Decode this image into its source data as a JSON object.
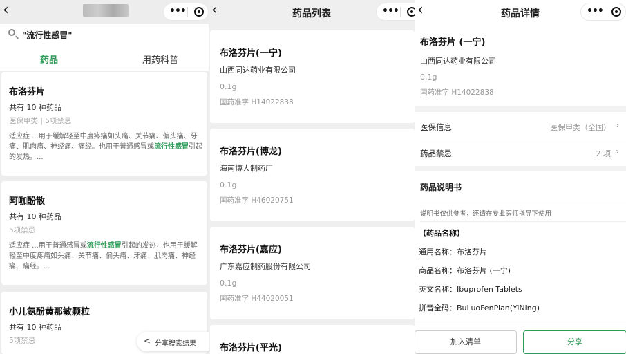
{
  "colors": {
    "accent": "#2e9b59",
    "muted": "#999999",
    "bg": "#ededed"
  },
  "icons": {
    "back": "chevron-left-icon",
    "more": "more-dots-icon",
    "target": "target-icon",
    "search": "search-icon"
  },
  "panel1": {
    "search_value": "\"流行性感冒\"",
    "tabs": [
      "药品",
      "用药科普"
    ],
    "cards": [
      {
        "name": "布洛芬片",
        "count": "共有 10 种药品",
        "meta": "医保甲类 | 5项禁忌",
        "desc_pre": "适应症 ...用于缓解轻至中度疼痛如头痛、关节痛、偏头痛、牙痛、肌肉痛、神经痛、痛经。也用于普通感冒或",
        "desc_hl": "流行性感冒",
        "desc_post": "引起的发热。..."
      },
      {
        "name": "阿咖酚散",
        "count": "共有 10 种药品",
        "meta": "5项禁忌",
        "desc_pre": "适应症 ...用于普通感冒或",
        "desc_hl": "流行性感冒",
        "desc_post": "引起的发热，也用于缓解轻至中度疼痛如头痛、关节痛、偏头痛、牙痛、肌肉痛、神经痛、痛经。..."
      },
      {
        "name": "小儿氨酚黄那敏颗粒",
        "count": "共有 10 种药品",
        "meta": "5项禁忌"
      }
    ],
    "share_label": "分享搜索结果"
  },
  "panel2": {
    "title": "药品列表",
    "items": [
      {
        "name": "布洛芬片(一宁)",
        "maker": "山西同达药业有限公司",
        "spec": "0.1g",
        "approval": "国药准字 H14022838"
      },
      {
        "name": "布洛芬片(博龙)",
        "maker": "海南博大制药厂",
        "spec": "0.1g",
        "approval": "国药准字 H46020751"
      },
      {
        "name": "布洛芬片(嘉应)",
        "maker": "广东嘉应制药股份有限公司",
        "spec": "0.1g",
        "approval": "国药准字 H44020051"
      },
      {
        "name": "布洛芬片(平光)"
      }
    ]
  },
  "panel3": {
    "title": "药品详情",
    "name": "布洛芬片 (一宁)",
    "maker": "山西同达药业有限公司",
    "spec": "0.1g",
    "approval": "国药准字 H14022838",
    "insurance_label": "医保信息",
    "insurance_value": "医保甲类（全国）",
    "taboo_label": "药品禁忌",
    "taboo_value": "2 项",
    "manual_title": "药品说明书",
    "notice": "说明书仅供参考，还请在专业医师指导下使用",
    "section_label": "【药品名称】",
    "generic_name": "通用名称：布洛芬片",
    "brand_name": "商品名称：布洛芬片 (一宁)",
    "english_name": "英文名称：Ibuprofen Tablets",
    "pinyin_name": "拼音全码：BuLuoFenPian(YiNing)",
    "btn_add": "加入清单",
    "btn_share": "分享"
  }
}
